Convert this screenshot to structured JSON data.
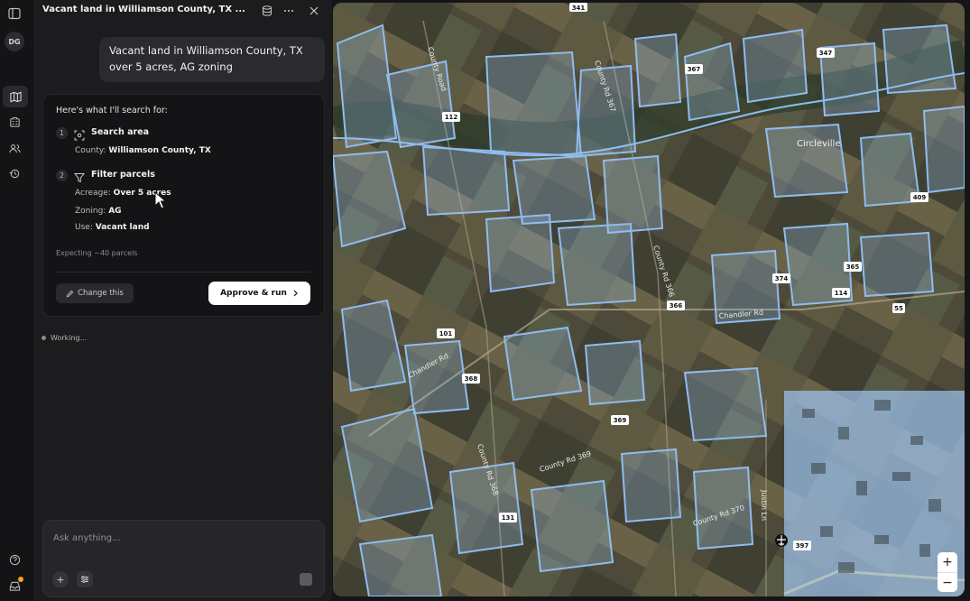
{
  "rail": {
    "avatar_initials": "DG",
    "icons": [
      "sidebar-toggle-icon",
      "map-icon",
      "building-icon",
      "users-icon",
      "history-icon",
      "help-icon",
      "inbox-icon"
    ]
  },
  "chat": {
    "title": "Vacant land in Williamson County, TX ...",
    "user_message": "Vacant land in Williamson County, TX over 5 acres, AG zoning",
    "plan": {
      "heading": "Here's what I'll search for:",
      "steps": [
        {
          "num": "1",
          "label": "Search area",
          "rows": [
            {
              "key": "County:",
              "value": "Williamson County, TX"
            }
          ]
        },
        {
          "num": "2",
          "label": "Filter parcels",
          "rows": [
            {
              "key": "Acreage:",
              "value": "Over 5 acres"
            },
            {
              "key": "Zoning:",
              "value": "AG"
            },
            {
              "key": "Use:",
              "value": "Vacant land"
            }
          ]
        }
      ],
      "expecting": "Expecting ~40 parcels",
      "change_label": "Change this",
      "approve_label": "Approve & run"
    },
    "status": "Working...",
    "composer_placeholder": "Ask anything..."
  },
  "map": {
    "places": [
      "Circleville"
    ],
    "roads": [
      "Chandler Rd",
      "County Rd 369",
      "County Rd 366",
      "County Rd 370",
      "Justin Ln",
      "County Rd 368",
      "County Rd 367",
      "County Road",
      "Chandler Rd"
    ],
    "shields": [
      "341",
      "112",
      "366",
      "365",
      "114",
      "374",
      "101",
      "368",
      "369",
      "131",
      "397",
      "367",
      "347",
      "409",
      "55"
    ],
    "zoom_in": "+",
    "zoom_out": "−"
  },
  "colors": {
    "parcel": "#8fbcef",
    "parcel_fill": "#9fc6f2",
    "accent": "#ffffff"
  }
}
